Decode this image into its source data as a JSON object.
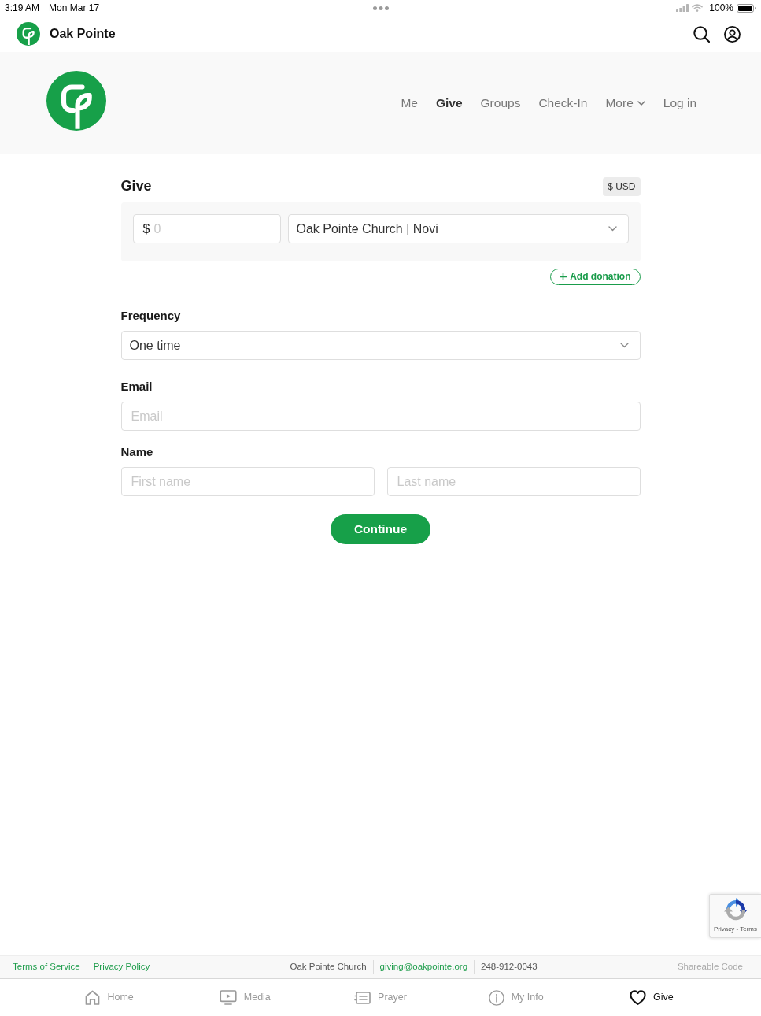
{
  "status_bar": {
    "time": "3:19 AM",
    "date": "Mon Mar 17",
    "battery": "100%"
  },
  "app_header": {
    "title": "Oak Pointe"
  },
  "site_nav": [
    {
      "label": "Me",
      "kind": "link",
      "selected": false
    },
    {
      "label": "Give",
      "kind": "link",
      "selected": true
    },
    {
      "label": "Groups",
      "kind": "link",
      "selected": false
    },
    {
      "label": "Check-In",
      "kind": "link",
      "selected": false
    },
    {
      "label": "More",
      "kind": "dropdown",
      "selected": false
    },
    {
      "label": "Log in",
      "kind": "link",
      "selected": false
    }
  ],
  "give": {
    "title": "Give",
    "currency": "$ USD",
    "donations": [
      {
        "symbol": "$",
        "amount_placeholder": "0",
        "fund": "Oak Pointe Church | Novi"
      }
    ],
    "add_button": "Add donation"
  },
  "frequency": {
    "label": "Frequency",
    "value": "One time"
  },
  "email": {
    "label": "Email",
    "placeholder": "Email"
  },
  "name": {
    "label": "Name",
    "first_placeholder": "First name",
    "last_placeholder": "Last name"
  },
  "continue_button": "Continue",
  "recaptcha": {
    "links": "Privacy - Terms"
  },
  "footer": {
    "left": [
      "Terms of Service",
      "Privacy Policy"
    ],
    "center": [
      {
        "text": "Oak Pointe Church",
        "kind": "text"
      },
      {
        "text": "giving@oakpointe.org",
        "kind": "link"
      },
      {
        "text": "248-912-0043",
        "kind": "text"
      }
    ],
    "right": "Shareable Code"
  },
  "tab_bar": [
    {
      "label": "Home",
      "selected": false
    },
    {
      "label": "Media",
      "selected": false
    },
    {
      "label": "Prayer",
      "selected": false
    },
    {
      "label": "My Info",
      "selected": false
    },
    {
      "label": "Give",
      "selected": true
    }
  ]
}
